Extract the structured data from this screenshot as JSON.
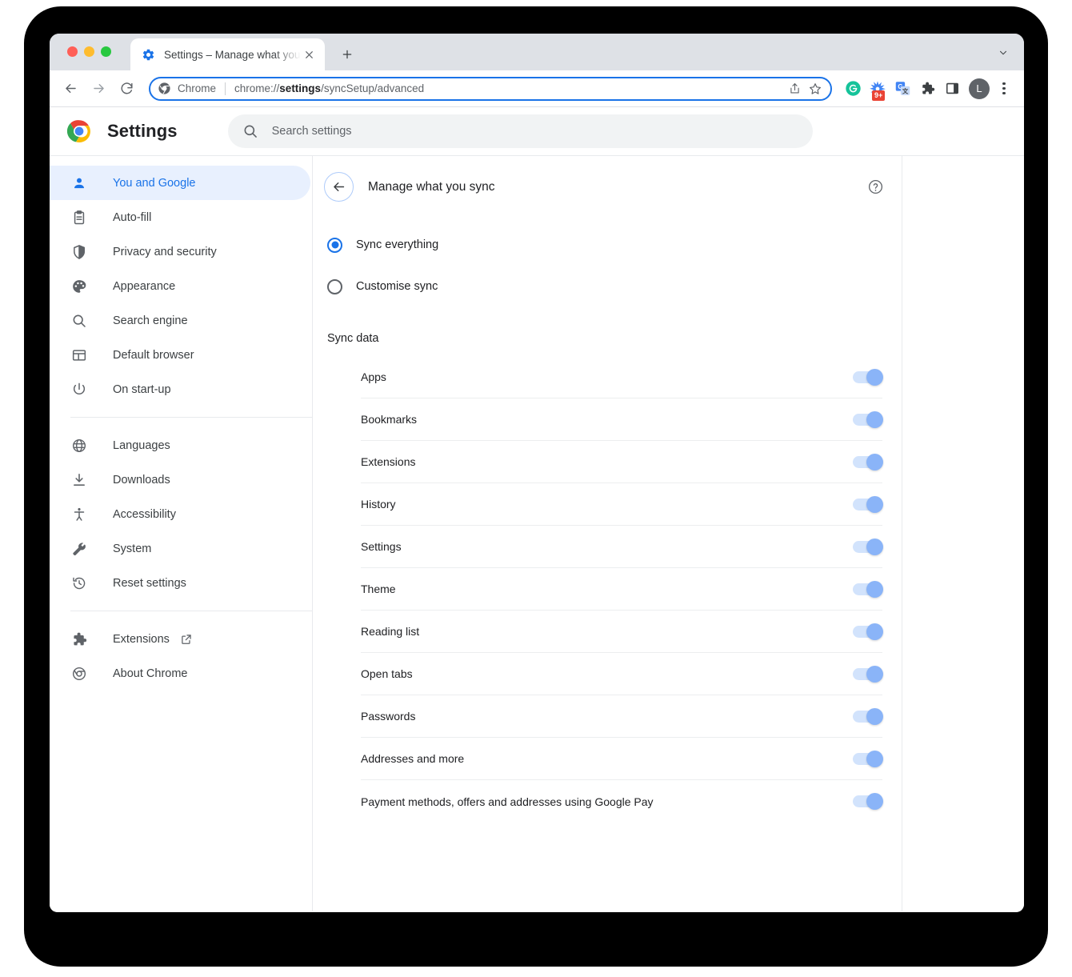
{
  "browser": {
    "tab": {
      "title": "Settings – Manage what you sy",
      "favicon_name": "settings-gear-favicon",
      "close_label": "✕"
    },
    "new_tab_label": "+",
    "tabstrip_chevron_label": "⌄",
    "toolbar": {
      "back_label": "←",
      "forward_label": "→",
      "reload_label": "⟳",
      "omnibox": {
        "scheme_label": "Chrome",
        "url_prefix": "chrome://",
        "url_bold": "settings",
        "url_suffix": "/syncSetup/advanced",
        "full_url": "chrome://settings/syncSetup/advanced",
        "share_icon": "share-icon",
        "bookmark_icon": "star-icon"
      },
      "extensions": [
        {
          "name": "grammarly-extension-icon",
          "letter": "G"
        },
        {
          "name": "starburst-extension-icon",
          "badge": "9+"
        },
        {
          "name": "google-translate-extension-icon"
        },
        {
          "name": "extensions-puzzle-icon"
        },
        {
          "name": "side-panel-icon"
        }
      ],
      "avatar_letter": "L",
      "menu_icon": "three-dot-menu-icon"
    }
  },
  "settings": {
    "logo_name": "chrome-logo",
    "title": "Settings",
    "search": {
      "icon": "search-icon",
      "placeholder": "Search settings",
      "value": ""
    },
    "sidebar": {
      "primary": [
        {
          "label": "You and Google",
          "icon": "person-icon",
          "active": true
        },
        {
          "label": "Auto-fill",
          "icon": "clipboard-icon",
          "active": false
        },
        {
          "label": "Privacy and security",
          "icon": "shield-icon",
          "active": false
        },
        {
          "label": "Appearance",
          "icon": "palette-icon",
          "active": false
        },
        {
          "label": "Search engine",
          "icon": "search-icon",
          "active": false
        },
        {
          "label": "Default browser",
          "icon": "browser-window-icon",
          "active": false
        },
        {
          "label": "On start-up",
          "icon": "power-icon",
          "active": false
        }
      ],
      "secondary": [
        {
          "label": "Languages",
          "icon": "globe-icon"
        },
        {
          "label": "Downloads",
          "icon": "download-icon"
        },
        {
          "label": "Accessibility",
          "icon": "accessibility-icon"
        },
        {
          "label": "System",
          "icon": "wrench-icon"
        },
        {
          "label": "Reset settings",
          "icon": "history-restore-icon"
        }
      ],
      "tertiary": [
        {
          "label": "Extensions",
          "icon": "puzzle-icon",
          "external": true
        },
        {
          "label": "About Chrome",
          "icon": "chrome-outline-icon",
          "external": false
        }
      ]
    },
    "content": {
      "back_icon": "back-arrow-icon",
      "title": "Manage what you sync",
      "help_icon": "help-circle-icon",
      "radios": [
        {
          "label": "Sync everything",
          "checked": true
        },
        {
          "label": "Customise sync",
          "checked": false
        }
      ],
      "sync_data_heading": "Sync data",
      "sync_items": [
        {
          "label": "Apps",
          "on": true
        },
        {
          "label": "Bookmarks",
          "on": true
        },
        {
          "label": "Extensions",
          "on": true
        },
        {
          "label": "History",
          "on": true
        },
        {
          "label": "Settings",
          "on": true
        },
        {
          "label": "Theme",
          "on": true
        },
        {
          "label": "Reading list",
          "on": true
        },
        {
          "label": "Open tabs",
          "on": true
        },
        {
          "label": "Passwords",
          "on": true
        },
        {
          "label": "Addresses and more",
          "on": true
        },
        {
          "label": "Payment methods, offers and addresses using Google Pay",
          "on": true
        }
      ]
    }
  },
  "colors": {
    "accent_blue": "#1a73e8",
    "active_nav_bg": "#e8f0fe",
    "toggle_track": "#d2e3fc",
    "toggle_knob": "#8ab4f8",
    "tabstrip_bg": "#dee1e6",
    "badge_red": "#ea4335"
  }
}
